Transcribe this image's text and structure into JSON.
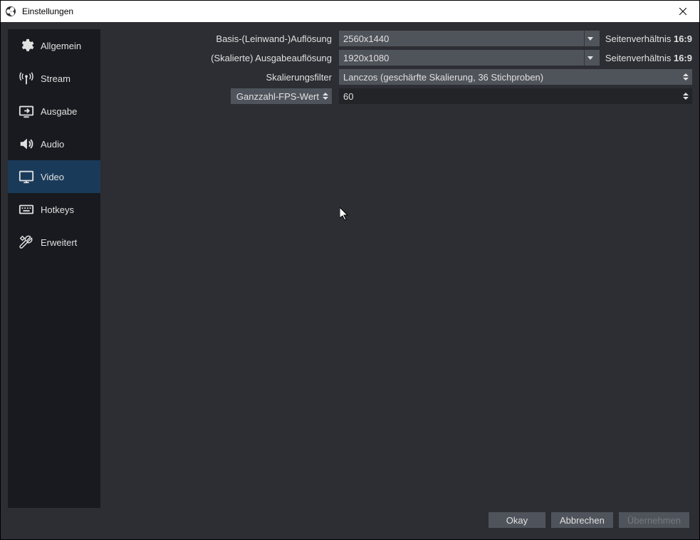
{
  "window": {
    "title": "Einstellungen"
  },
  "sidebar": {
    "items": [
      {
        "label": "Allgemein",
        "icon": "gear-icon",
        "active": false
      },
      {
        "label": "Stream",
        "icon": "stream-icon",
        "active": false
      },
      {
        "label": "Ausgabe",
        "icon": "output-icon",
        "active": false
      },
      {
        "label": "Audio",
        "icon": "audio-icon",
        "active": false
      },
      {
        "label": "Video",
        "icon": "video-icon",
        "active": true
      },
      {
        "label": "Hotkeys",
        "icon": "hotkeys-icon",
        "active": false
      },
      {
        "label": "Erweitert",
        "icon": "advanced-icon",
        "active": false
      }
    ]
  },
  "video": {
    "base_res_label": "Basis-(Leinwand-)Auflösung",
    "base_res_value": "2560x1440",
    "base_res_aspect_prefix": "Seitenverhältnis",
    "base_res_aspect_ratio": "16:9",
    "output_res_label": "(Skalierte) Ausgabeauflösung",
    "output_res_value": "1920x1080",
    "output_res_aspect_prefix": "Seitenverhältnis",
    "output_res_aspect_ratio": "16:9",
    "downscale_filter_label": "Skalierungsfilter",
    "downscale_filter_value": "Lanczos (geschärfte Skalierung, 36 Stichproben)",
    "fps_type_label": "Ganzzahl-FPS-Wert",
    "fps_value": "60"
  },
  "footer": {
    "ok": "Okay",
    "cancel": "Abbrechen",
    "apply": "Übernehmen"
  }
}
